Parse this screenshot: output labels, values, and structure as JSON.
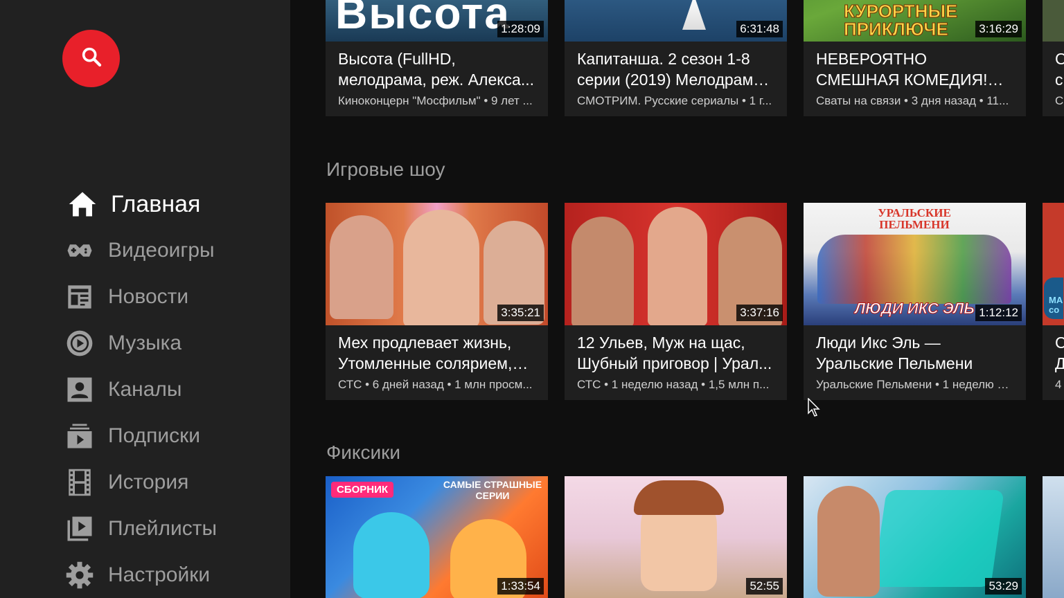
{
  "sidebar": {
    "search_icon": "search-icon",
    "items": [
      {
        "label": "Главная",
        "icon": "home-icon",
        "active": true
      },
      {
        "label": "Видеоигры",
        "icon": "gamepad-icon"
      },
      {
        "label": "Новости",
        "icon": "news-icon"
      },
      {
        "label": "Музыка",
        "icon": "music-icon"
      },
      {
        "label": "Каналы",
        "icon": "channels-icon"
      },
      {
        "label": "Подписки",
        "icon": "subscriptions-icon"
      },
      {
        "label": "История",
        "icon": "history-icon"
      },
      {
        "label": "Плейлисты",
        "icon": "playlists-icon"
      },
      {
        "label": "Настройки",
        "icon": "settings-icon"
      }
    ]
  },
  "shelves": [
    {
      "title": "",
      "videos": [
        {
          "title": "Высота (FullHD, мелодрама, реж. Алекса...",
          "subtitle": "Киноконцерн \"Мосфильм\" • 9 лет ...",
          "duration": "1:28:09",
          "thumb_text": "Высота"
        },
        {
          "title": "Капитанша. 2 сезон 1-8 серии (2019) Мелодрама ...",
          "subtitle": "СМОТРИМ. Русские сериалы • 1 г...",
          "duration": "6:31:48",
          "thumb_text": ""
        },
        {
          "title": "НЕВЕРОЯТНО СМЕШНАЯ КОМЕДИЯ! \"Курортные п...",
          "subtitle": "Сваты на связи • 3 дня назад • 11...",
          "duration": "3:16:29",
          "thumb_text": "КУРОРТНЫЕ ПРИКЛЮЧЕ"
        }
      ],
      "peek_title": "С с",
      "peek_sub": "С"
    },
    {
      "title": "Игровые шоу",
      "videos": [
        {
          "title": "Мех продлевает жизнь, Утомленные солярием, Н...",
          "subtitle": "СТС • 6 дней назад • 1 млн просм...",
          "duration": "3:35:21",
          "thumb_text": ""
        },
        {
          "title": "12 Ульев, Муж на щас, Шубный приговор | Урал...",
          "subtitle": "СТС • 1 неделю назад • 1,5 млн п...",
          "duration": "3:37:16",
          "thumb_text": ""
        },
        {
          "title": "Люди Икс Эль — Уральские Пельмени",
          "subtitle": "Уральские Пельмени • 1 неделю н...",
          "duration": "1:12:12",
          "thumb_text": "УРАЛЬСКИЕ ПЕЛЬМЕНИ",
          "thumb_text2": "ЛЮДИ ИКС ЭЛЬ"
        }
      ],
      "peek_title": "С Д",
      "peek_sub": "4",
      "peek_thumb_text": "МА со"
    },
    {
      "title": "Фиксики",
      "videos": [
        {
          "title": "",
          "subtitle": "",
          "duration": "1:33:54",
          "thumb_text": "СБОРНИК",
          "thumb_text2": "САМЫЕ СТРАШНЫЕ СЕРИИ"
        },
        {
          "title": "",
          "subtitle": "",
          "duration": "52:55",
          "thumb_text": ""
        },
        {
          "title": "",
          "subtitle": "",
          "duration": "53:29",
          "thumb_text": ""
        }
      ]
    }
  ],
  "colors": {
    "accent": "#e8202a",
    "sidebar_bg": "#212121",
    "main_bg": "#0f0f0f",
    "card_bg": "#1f1f1f"
  }
}
